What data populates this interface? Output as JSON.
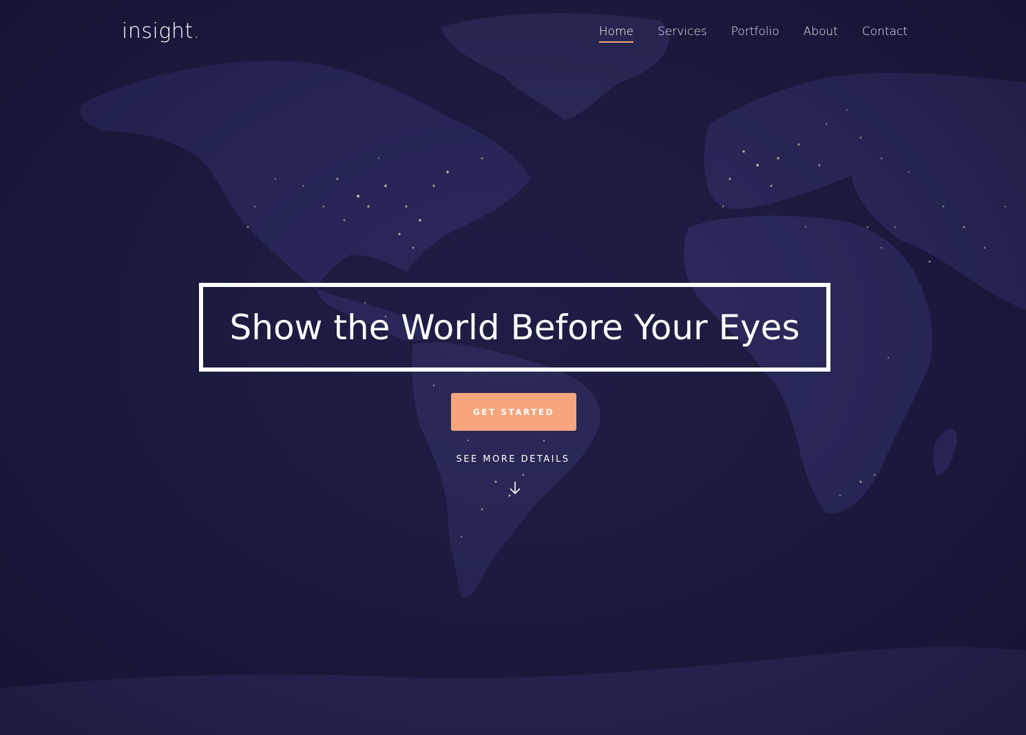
{
  "brand": {
    "name": "insight",
    "dot": "."
  },
  "nav": {
    "items": [
      {
        "label": "Home"
      },
      {
        "label": "Services"
      },
      {
        "label": "Portfolio"
      },
      {
        "label": "About"
      },
      {
        "label": "Contact"
      }
    ],
    "active": "Home"
  },
  "hero": {
    "headline": "Show the World Before Your Eyes",
    "cta_label": "GET STARTED",
    "see_more_label": "SEE MORE DETAILS",
    "arrow_icon": "arrow-down-icon"
  },
  "colors": {
    "accent": "#f7a57c",
    "background": "#1e1d45",
    "land": "#2b2a55",
    "city_lights": "#f4efc8",
    "text": "#ffffff"
  }
}
